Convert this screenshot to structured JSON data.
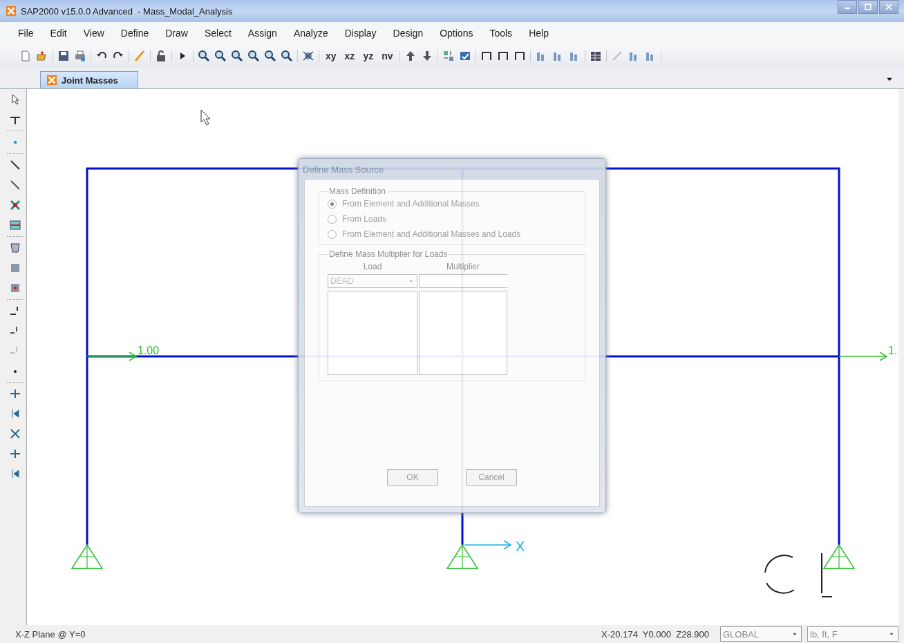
{
  "window": {
    "title": "SAP2000 v15.0.0 Advanced  - Mass_Modal_Analysis"
  },
  "menu": [
    "File",
    "Edit",
    "View",
    "Define",
    "Draw",
    "Select",
    "Assign",
    "Analyze",
    "Display",
    "Design",
    "Options",
    "Tools",
    "Help"
  ],
  "toolbar": {
    "view_buttons": [
      "xy",
      "xz",
      "yz",
      "nv"
    ]
  },
  "tabs": [
    {
      "label": "Joint Masses",
      "selected": true
    }
  ],
  "canvas": {
    "load_labels": [
      "1.00",
      "1."
    ],
    "axis_label": "X"
  },
  "dialog": {
    "title": "Define Mass Source",
    "mass_definition": {
      "title": "Mass Definition",
      "options": [
        {
          "label": "From Element and Additional Masses",
          "selected": true
        },
        {
          "label": "From Loads",
          "selected": false
        },
        {
          "label": "From Element and Additional Masses and Loads",
          "selected": false
        }
      ]
    },
    "multiplier": {
      "title": "Define Mass Multiplier for Loads",
      "columns": [
        "Load",
        "Multiplier"
      ],
      "load_value": "DEAD"
    },
    "buttons": [
      "OK",
      "Cancel"
    ]
  },
  "status_bar": {
    "plane": "X-Z Plane @ Y=0",
    "coordinates": "X-20.174  Y0.000  Z28.900",
    "coord_system": "GLOBAL",
    "units": "lb, ft, F"
  }
}
